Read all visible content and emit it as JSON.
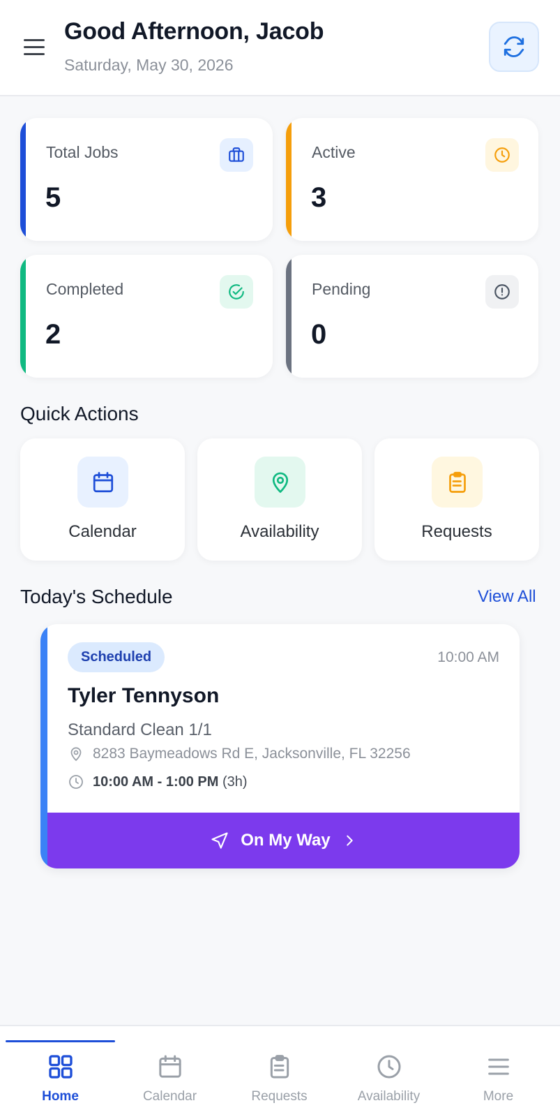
{
  "header": {
    "greeting": "Good Afternoon, Jacob",
    "date": "Saturday, May 30, 2026",
    "menu_icon": "hamburger-menu-icon",
    "refresh_icon": "refresh-icon"
  },
  "stats": [
    {
      "label": "Total Jobs",
      "value": "5",
      "icon": "briefcase-icon",
      "accent": "#1d4ed8"
    },
    {
      "label": "Active",
      "value": "3",
      "icon": "clock-icon",
      "accent": "#f59e0b"
    },
    {
      "label": "Completed",
      "value": "2",
      "icon": "check-circle-icon",
      "accent": "#10b981"
    },
    {
      "label": "Pending",
      "value": "0",
      "icon": "alert-circle-icon",
      "accent": "#6b7280"
    }
  ],
  "quick_actions": {
    "title": "Quick Actions",
    "items": [
      {
        "label": "Calendar",
        "icon": "calendar-icon"
      },
      {
        "label": "Availability",
        "icon": "map-pin-icon"
      },
      {
        "label": "Requests",
        "icon": "clipboard-icon"
      }
    ]
  },
  "schedule": {
    "title": "Today's Schedule",
    "view_all": "View All",
    "jobs": [
      {
        "status": "Scheduled",
        "time": "10:00 AM",
        "client": "Tyler Tennyson",
        "service": "Standard Clean 1/1",
        "address": "8283 Baymeadows Rd E, Jacksonville, FL 32256",
        "time_range": "10:00 AM - 1:00 PM",
        "duration": "(3h)",
        "action_label": "On My Way",
        "action_color": "#7c3aed"
      }
    ]
  },
  "bottom_nav": {
    "items": [
      {
        "label": "Home",
        "icon": "home-grid-icon",
        "active": true
      },
      {
        "label": "Calendar",
        "icon": "calendar-icon"
      },
      {
        "label": "Requests",
        "icon": "clipboard-icon"
      },
      {
        "label": "Availability",
        "icon": "clock-icon"
      },
      {
        "label": "More",
        "icon": "menu-icon"
      }
    ]
  }
}
